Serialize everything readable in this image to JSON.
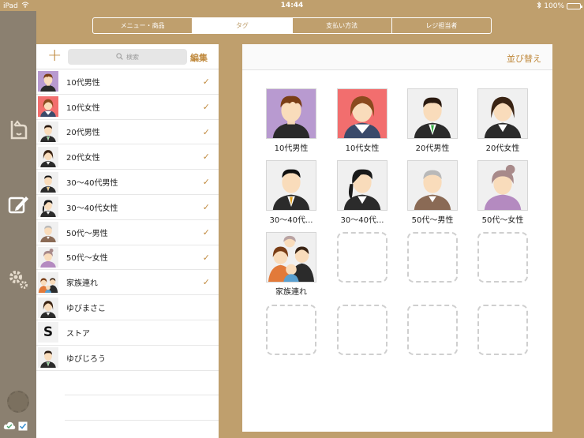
{
  "status": {
    "device": "iPad",
    "time": "14:44",
    "battery": "100%"
  },
  "segments": [
    {
      "label": "メニュー・商品",
      "active": false
    },
    {
      "label": "タグ",
      "active": true
    },
    {
      "label": "支払い方法",
      "active": false
    },
    {
      "label": "レジ担当者",
      "active": false
    }
  ],
  "list": {
    "add_label": "+",
    "search_placeholder": "検索",
    "edit_label": "編集",
    "items": [
      {
        "label": "10代男性",
        "checked": true
      },
      {
        "label": "10代女性",
        "checked": true
      },
      {
        "label": "20代男性",
        "checked": true
      },
      {
        "label": "20代女性",
        "checked": true
      },
      {
        "label": "30〜40代男性",
        "checked": true
      },
      {
        "label": "30〜40代女性",
        "checked": true
      },
      {
        "label": "50代〜男性",
        "checked": true
      },
      {
        "label": "50代〜女性",
        "checked": true
      },
      {
        "label": "家族連れ",
        "checked": true
      },
      {
        "label": "ゆびまさこ",
        "checked": false
      },
      {
        "label": "ストア",
        "checked": false
      },
      {
        "label": "ゆびじろう",
        "checked": false
      }
    ],
    "store_letter": "S",
    "check_glyph": "✓"
  },
  "grid": {
    "sort_label": "並び替え",
    "tiles": [
      {
        "label": "10代男性"
      },
      {
        "label": "10代女性"
      },
      {
        "label": "20代男性"
      },
      {
        "label": "20代女性"
      },
      {
        "label": "30〜40代..."
      },
      {
        "label": "30〜40代..."
      },
      {
        "label": "50代〜男性"
      },
      {
        "label": "50代〜女性"
      },
      {
        "label": "家族連れ"
      }
    ]
  }
}
